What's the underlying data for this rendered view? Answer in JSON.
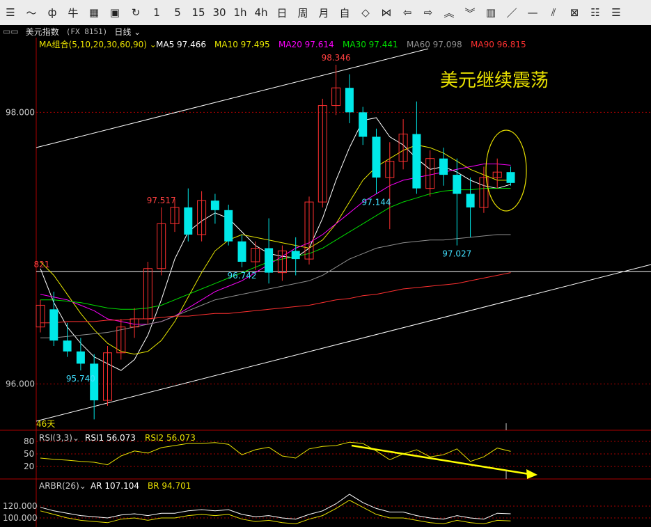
{
  "toolbar": {
    "buttons": [
      {
        "name": "list-icon",
        "glyph": "☰"
      },
      {
        "name": "line-chart-icon",
        "glyph": "〜"
      },
      {
        "name": "candlestick-icon",
        "glyph": "ф"
      },
      {
        "name": "indicator-icon",
        "glyph": "⽜"
      },
      {
        "name": "grid-icon",
        "glyph": "▦"
      },
      {
        "name": "save-icon",
        "glyph": "▣"
      },
      {
        "name": "refresh-icon",
        "glyph": "↻"
      },
      {
        "name": "period-1m",
        "glyph": "1"
      },
      {
        "name": "period-5m",
        "glyph": "5"
      },
      {
        "name": "period-15m",
        "glyph": "15"
      },
      {
        "name": "period-30m",
        "glyph": "30"
      },
      {
        "name": "period-1h",
        "glyph": "1h"
      },
      {
        "name": "period-4h",
        "glyph": "4h"
      },
      {
        "name": "period-day",
        "glyph": "日"
      },
      {
        "name": "period-week",
        "glyph": "周"
      },
      {
        "name": "period-month",
        "glyph": "月"
      },
      {
        "name": "period-custom",
        "glyph": "自"
      },
      {
        "name": "zoom-fit-icon",
        "glyph": "◇"
      },
      {
        "name": "zoom-out-icon",
        "glyph": "⋈"
      },
      {
        "name": "arrow-left-icon",
        "glyph": "⇦"
      },
      {
        "name": "arrow-right-icon",
        "glyph": "⇨"
      },
      {
        "name": "chevron-up-icon",
        "glyph": "︽"
      },
      {
        "name": "chevron-down-icon",
        "glyph": "︾"
      },
      {
        "name": "layout-icon",
        "glyph": "▥"
      },
      {
        "name": "draw-line-icon",
        "glyph": "／"
      },
      {
        "name": "draw-hline-icon",
        "glyph": "—"
      },
      {
        "name": "draw-parallel-icon",
        "glyph": "⫽"
      },
      {
        "name": "draw-channel-icon",
        "glyph": "⊠"
      },
      {
        "name": "fib-icon",
        "glyph": "☷"
      },
      {
        "name": "more-draw-icon",
        "glyph": "☰"
      }
    ]
  },
  "header": {
    "title": "美元指数",
    "code": "(FX 8151)",
    "period": "日线"
  },
  "legend": {
    "group_label": "MA组合(5,10,20,30,60,90)",
    "items": [
      {
        "label": "MA5 97.466",
        "color": "#ffffff"
      },
      {
        "label": "MA10 97.495",
        "color": "#e8e800"
      },
      {
        "label": "MA20 97.614",
        "color": "#ff00ff"
      },
      {
        "label": "MA30 97.441",
        "color": "#00e000"
      },
      {
        "label": "MA60 97.098",
        "color": "#909090"
      },
      {
        "label": "MA90 96.815",
        "color": "#ff3030"
      }
    ]
  },
  "rsi": {
    "label": "RSI(3,3)",
    "rsi1": "RSI1 56.073",
    "rsi2": "RSI2 56.073",
    "ticks": [
      "80",
      "50",
      "20"
    ]
  },
  "arbr": {
    "label": "ARBR(26)",
    "ar": "AR 107.104",
    "br": "BR 94.701",
    "ticks": [
      "120.000",
      "100.000"
    ]
  },
  "chart_data": {
    "type": "candlestick",
    "annotation": "美元继续震荡",
    "y_ticks": [
      98.0,
      96.0
    ],
    "ylim": [
      95.66,
      98.55
    ],
    "bars_label": "46天",
    "price_labels": [
      {
        "text": "98.346",
        "kind": "high",
        "index": 22
      },
      {
        "text": "97.517",
        "kind": "high",
        "index": 9
      },
      {
        "text": "97.144",
        "kind": "low",
        "index": 25
      },
      {
        "text": "97.027",
        "kind": "low",
        "index": 31
      },
      {
        "text": "96.742",
        "kind": "low",
        "index": 15
      },
      {
        "text": "95.740",
        "kind": "low",
        "index": 3
      },
      {
        "text": "821",
        "kind": "level",
        "index": 0
      }
    ],
    "candles": [
      {
        "o": 96.42,
        "h": 96.62,
        "l": 96.38,
        "c": 96.58
      },
      {
        "o": 96.55,
        "h": 96.68,
        "l": 96.28,
        "c": 96.32
      },
      {
        "o": 96.32,
        "h": 96.45,
        "l": 96.2,
        "c": 96.24
      },
      {
        "o": 96.24,
        "h": 96.34,
        "l": 96.1,
        "c": 96.15
      },
      {
        "o": 96.15,
        "h": 96.22,
        "l": 95.74,
        "c": 95.88
      },
      {
        "o": 95.88,
        "h": 96.28,
        "l": 95.84,
        "c": 96.23
      },
      {
        "o": 96.23,
        "h": 96.48,
        "l": 96.18,
        "c": 96.42
      },
      {
        "o": 96.42,
        "h": 96.56,
        "l": 96.34,
        "c": 96.48
      },
      {
        "o": 96.48,
        "h": 96.9,
        "l": 96.44,
        "c": 96.85
      },
      {
        "o": 96.85,
        "h": 97.3,
        "l": 96.8,
        "c": 97.18
      },
      {
        "o": 97.18,
        "h": 97.36,
        "l": 97.12,
        "c": 97.3
      },
      {
        "o": 97.3,
        "h": 97.44,
        "l": 97.05,
        "c": 97.1
      },
      {
        "o": 97.1,
        "h": 97.42,
        "l": 97.05,
        "c": 97.35
      },
      {
        "o": 97.35,
        "h": 97.4,
        "l": 97.18,
        "c": 97.28
      },
      {
        "o": 97.28,
        "h": 97.32,
        "l": 97.02,
        "c": 97.05
      },
      {
        "o": 97.05,
        "h": 97.1,
        "l": 96.86,
        "c": 96.9
      },
      {
        "o": 96.9,
        "h": 97.05,
        "l": 96.84,
        "c": 97.0
      },
      {
        "o": 97.0,
        "h": 97.22,
        "l": 96.74,
        "c": 96.82
      },
      {
        "o": 96.82,
        "h": 97.02,
        "l": 96.76,
        "c": 96.98
      },
      {
        "o": 96.98,
        "h": 97.08,
        "l": 96.8,
        "c": 96.92
      },
      {
        "o": 96.92,
        "h": 97.38,
        "l": 96.88,
        "c": 97.34
      },
      {
        "o": 97.34,
        "h": 98.1,
        "l": 97.3,
        "c": 98.05
      },
      {
        "o": 98.05,
        "h": 98.35,
        "l": 97.98,
        "c": 98.18
      },
      {
        "o": 98.18,
        "h": 98.28,
        "l": 97.92,
        "c": 98.0
      },
      {
        "o": 98.0,
        "h": 98.04,
        "l": 97.76,
        "c": 97.82
      },
      {
        "o": 97.82,
        "h": 97.88,
        "l": 97.4,
        "c": 97.52
      },
      {
        "o": 97.52,
        "h": 97.78,
        "l": 97.14,
        "c": 97.64
      },
      {
        "o": 97.64,
        "h": 97.95,
        "l": 97.58,
        "c": 97.84
      },
      {
        "o": 97.84,
        "h": 98.08,
        "l": 97.4,
        "c": 97.44
      },
      {
        "o": 97.44,
        "h": 97.72,
        "l": 97.38,
        "c": 97.66
      },
      {
        "o": 97.66,
        "h": 97.74,
        "l": 97.46,
        "c": 97.54
      },
      {
        "o": 97.54,
        "h": 97.66,
        "l": 97.02,
        "c": 97.4
      },
      {
        "o": 97.4,
        "h": 97.52,
        "l": 97.08,
        "c": 97.3
      },
      {
        "o": 97.3,
        "h": 97.6,
        "l": 97.26,
        "c": 97.52
      },
      {
        "o": 97.52,
        "h": 97.66,
        "l": 97.44,
        "c": 97.56
      },
      {
        "o": 97.56,
        "h": 97.6,
        "l": 97.46,
        "c": 97.48
      }
    ],
    "ma": [
      {
        "name": "MA5",
        "color": "#ffffff",
        "values": [
          96.85,
          96.6,
          96.42,
          96.3,
          96.2,
          96.15,
          96.1,
          96.18,
          96.36,
          96.62,
          96.92,
          97.12,
          97.2,
          97.26,
          97.22,
          97.12,
          97.02,
          96.96,
          96.94,
          96.93,
          97.0,
          97.22,
          97.5,
          97.74,
          97.94,
          97.96,
          97.82,
          97.76,
          97.66,
          97.58,
          97.6,
          97.56,
          97.5,
          97.46,
          97.44,
          97.47
        ]
      },
      {
        "name": "MA10",
        "color": "#e8e800",
        "values": [
          96.9,
          96.8,
          96.66,
          96.52,
          96.4,
          96.3,
          96.24,
          96.22,
          96.24,
          96.32,
          96.46,
          96.64,
          96.82,
          96.98,
          97.06,
          97.1,
          97.08,
          97.06,
          97.04,
          97.02,
          97.0,
          97.06,
          97.18,
          97.34,
          97.5,
          97.6,
          97.66,
          97.72,
          97.76,
          97.74,
          97.7,
          97.64,
          97.58,
          97.54,
          97.5,
          97.5
        ]
      },
      {
        "name": "MA20",
        "color": "#ff00ff",
        "values": [
          96.66,
          96.64,
          96.62,
          96.58,
          96.54,
          96.48,
          96.46,
          96.44,
          96.44,
          96.46,
          96.5,
          96.56,
          96.62,
          96.68,
          96.72,
          96.76,
          96.82,
          96.88,
          96.94,
          97.0,
          97.04,
          97.1,
          97.18,
          97.26,
          97.34,
          97.4,
          97.46,
          97.5,
          97.52,
          97.54,
          97.56,
          97.58,
          97.6,
          97.62,
          97.62,
          97.61
        ]
      },
      {
        "name": "MA30",
        "color": "#00e000",
        "values": [
          96.62,
          96.62,
          96.61,
          96.6,
          96.58,
          96.56,
          96.55,
          96.55,
          96.56,
          96.58,
          96.62,
          96.66,
          96.7,
          96.74,
          96.78,
          96.82,
          96.86,
          96.9,
          96.92,
          96.94,
          96.96,
          97.0,
          97.06,
          97.12,
          97.18,
          97.24,
          97.3,
          97.34,
          97.37,
          97.4,
          97.42,
          97.43,
          97.43,
          97.44,
          97.44,
          97.44
        ]
      },
      {
        "name": "MA60",
        "color": "#909090",
        "values": [
          96.34,
          96.34,
          96.35,
          96.36,
          96.37,
          96.38,
          96.4,
          96.42,
          96.44,
          96.46,
          96.5,
          96.54,
          96.58,
          96.62,
          96.64,
          96.66,
          96.68,
          96.7,
          96.72,
          96.74,
          96.76,
          96.8,
          96.86,
          96.92,
          96.96,
          97.0,
          97.02,
          97.04,
          97.05,
          97.06,
          97.06,
          97.07,
          97.08,
          97.09,
          97.1,
          97.1
        ]
      },
      {
        "name": "MA90",
        "color": "#ff3030",
        "values": [
          96.45,
          96.45,
          96.46,
          96.46,
          96.46,
          96.47,
          96.47,
          96.48,
          96.48,
          96.49,
          96.5,
          96.5,
          96.51,
          96.52,
          96.52,
          96.53,
          96.54,
          96.55,
          96.56,
          96.57,
          96.58,
          96.6,
          96.62,
          96.63,
          96.65,
          96.66,
          96.68,
          96.7,
          96.71,
          96.72,
          96.73,
          96.74,
          96.76,
          96.78,
          96.8,
          96.82
        ]
      }
    ],
    "rsi_values": [
      40,
      37,
      35,
      32,
      30,
      24,
      45,
      57,
      52,
      65,
      70,
      75,
      75,
      77,
      73,
      48,
      60,
      66,
      45,
      40,
      62,
      68,
      70,
      78,
      75,
      57,
      36,
      50,
      60,
      43,
      48,
      62,
      32,
      43,
      64,
      56
    ],
    "ar_values": [
      118,
      112,
      108,
      104,
      102,
      100,
      105,
      107,
      104,
      108,
      108,
      112,
      114,
      112,
      114,
      106,
      102,
      104,
      100,
      98,
      106,
      112,
      124,
      140,
      126,
      116,
      110,
      110,
      104,
      100,
      98,
      104,
      100,
      98,
      108,
      107
    ],
    "br_values": [
      112,
      106,
      100,
      96,
      94,
      92,
      98,
      100,
      96,
      100,
      100,
      104,
      106,
      104,
      106,
      98,
      94,
      96,
      92,
      90,
      98,
      104,
      116,
      130,
      118,
      106,
      100,
      100,
      96,
      92,
      90,
      96,
      92,
      90,
      96,
      95
    ]
  }
}
